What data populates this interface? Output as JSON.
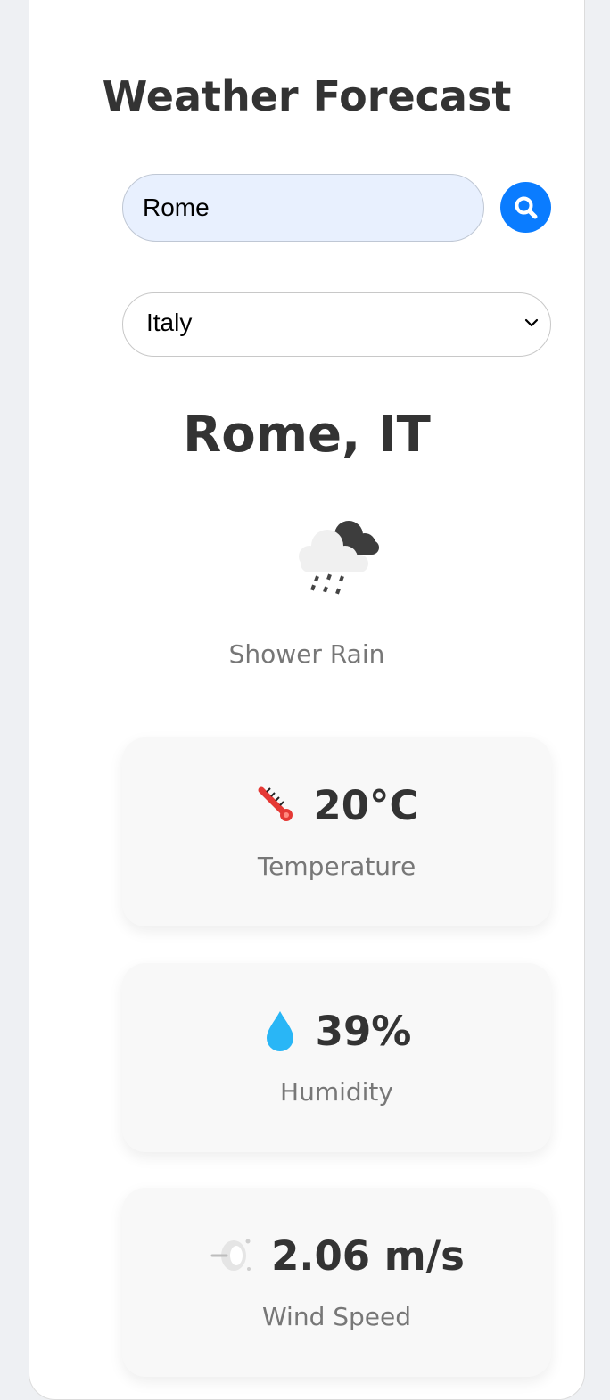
{
  "header": {
    "title": "Weather Forecast"
  },
  "search": {
    "value": "Rome",
    "icon": "search-icon"
  },
  "country_select": {
    "selected": "Italy"
  },
  "location": {
    "city": "Rome, IT"
  },
  "current": {
    "condition": "Shower Rain",
    "icon": "shower-rain-icon"
  },
  "stats": {
    "temperature": {
      "value": "20°C",
      "label": "Temperature",
      "icon": "thermometer-icon"
    },
    "humidity": {
      "value": "39%",
      "label": "Humidity",
      "icon": "droplet-icon"
    },
    "wind": {
      "value": "2.06 m/s",
      "label": "Wind Speed",
      "icon": "wind-icon"
    }
  },
  "colors": {
    "accent": "#0a7cff",
    "heading": "#333333",
    "muted": "#777777",
    "input_bg": "#e8f0fe"
  }
}
